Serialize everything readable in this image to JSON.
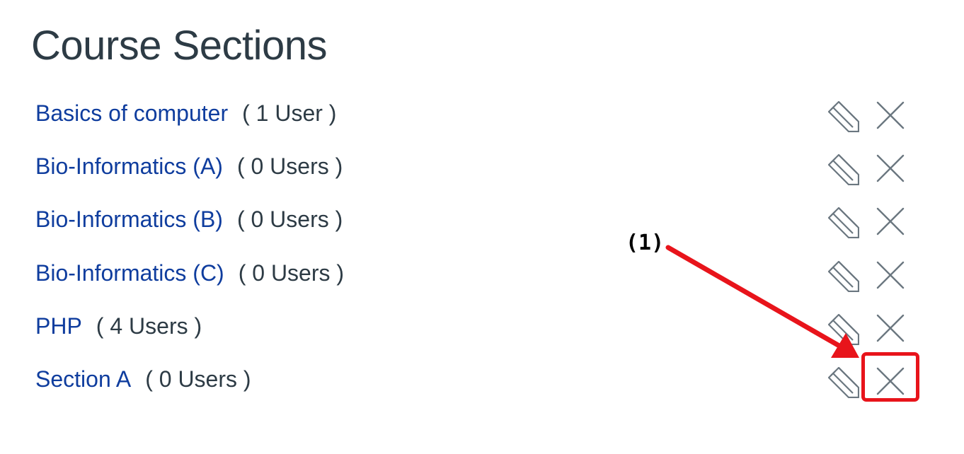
{
  "page": {
    "title": "Course Sections"
  },
  "sections": [
    {
      "name": "Basics of computer",
      "count": "( 1 User )"
    },
    {
      "name": "Bio-Informatics (A)",
      "count": "( 0 Users )"
    },
    {
      "name": "Bio-Informatics (B)",
      "count": "( 0 Users )"
    },
    {
      "name": "Bio-Informatics (C)",
      "count": "( 0 Users )"
    },
    {
      "name": "PHP",
      "count": "( 4 Users )"
    },
    {
      "name": "Section A",
      "count": "( 0 Users )"
    }
  ],
  "icons": {
    "edit": "pencil-icon",
    "delete": "close-icon"
  },
  "annotation": {
    "label": "(1)",
    "color": "#e8141b"
  },
  "colors": {
    "link": "#0f3d9e",
    "text": "#2d3b45",
    "icon": "#6b7780"
  }
}
